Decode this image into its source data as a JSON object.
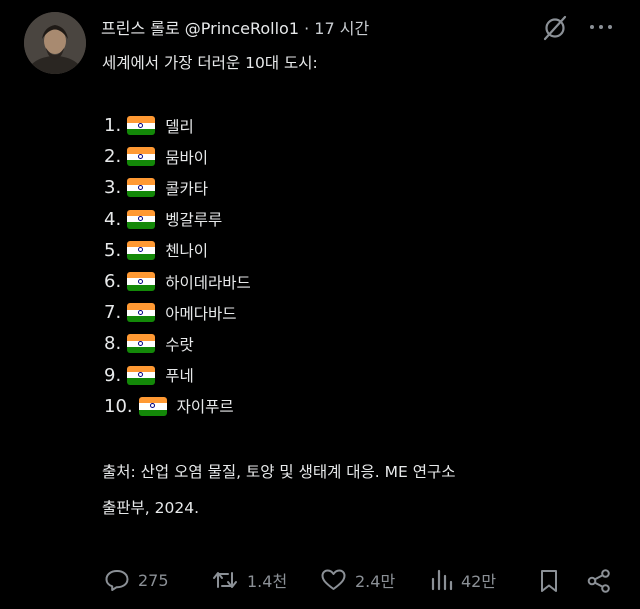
{
  "post": {
    "author_name": "프린스 롤로",
    "author_handle": "@PrinceRollo1",
    "separator": "·",
    "time_ago": "17 시간",
    "intro": "세계에서 가장 더러운 10대 도시:",
    "cities": [
      {
        "num": "1.",
        "name": "델리"
      },
      {
        "num": "2.",
        "name": "뭄바이"
      },
      {
        "num": "3.",
        "name": "콜카타"
      },
      {
        "num": "4.",
        "name": "벵갈루루"
      },
      {
        "num": "5.",
        "name": "첸나이"
      },
      {
        "num": "6.",
        "name": "하이데라바드"
      },
      {
        "num": "7.",
        "name": "아메다바드"
      },
      {
        "num": "8.",
        "name": "수랏"
      },
      {
        "num": "9.",
        "name": "푸네"
      },
      {
        "num": "10.",
        "name": "자이푸르"
      }
    ],
    "source_line1": "출처: 산업 오염 물질, 토양 및 생태계 대응. ME 연구소",
    "source_line2": "출판부, 2024."
  },
  "actions": {
    "reply_count": "275",
    "repost_count": "1.4천",
    "like_count": "2.4만",
    "views_count": "42만"
  },
  "icons": {
    "grok": "grok-icon",
    "more": "more-icon",
    "reply": "reply-icon",
    "repost": "repost-icon",
    "like": "heart-icon",
    "views": "views-icon",
    "bookmark": "bookmark-icon",
    "share": "share-icon",
    "flag": "india-flag-icon"
  },
  "colors": {
    "background": "#000000",
    "text": "#e7e9ea",
    "muted": "#8b9096",
    "flag_saffron": "#ff9933",
    "flag_green": "#138808"
  }
}
